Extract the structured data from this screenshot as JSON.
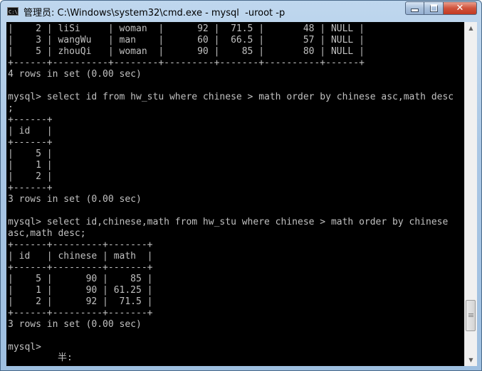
{
  "window": {
    "title": "管理员: C:\\Windows\\system32\\cmd.exe - mysql  -uroot -p",
    "icon": "C:\\",
    "minimize_icon": "minimize-icon",
    "maximize_icon": "maximize-icon",
    "close_label": "✕"
  },
  "console": {
    "lines": [
      "|    2 | liSi     | woman  |      92 |  71.5 |       48 | NULL |",
      "|    3 | wangWu   | man    |      60 |  66.5 |       57 | NULL |",
      "|    5 | zhouQi   | woman  |      90 |    85 |       80 | NULL |",
      "+------+----------+--------+---------+-------+----------+------+",
      "4 rows in set (0.00 sec)",
      "",
      "mysql> select id from hw_stu where chinese > math order by chinese asc,math desc",
      ";",
      "+------+",
      "| id   |",
      "+------+",
      "|    5 |",
      "|    1 |",
      "|    2 |",
      "+------+",
      "3 rows in set (0.00 sec)",
      "",
      "mysql> select id,chinese,math from hw_stu where chinese > math order by chinese",
      "asc,math desc;",
      "+------+---------+-------+",
      "| id   | chinese | math  |",
      "+------+---------+-------+",
      "|    5 |      90 |    85 |",
      "|    1 |      90 | 61.25 |",
      "|    2 |      92 |  71.5 |",
      "+------+---------+-------+",
      "3 rows in set (0.00 sec)",
      "",
      "mysql>"
    ],
    "ime_indicator": "半:"
  },
  "scrollbar": {
    "up_arrow": "▲",
    "down_arrow": "▼",
    "position_fraction": 0.92
  }
}
